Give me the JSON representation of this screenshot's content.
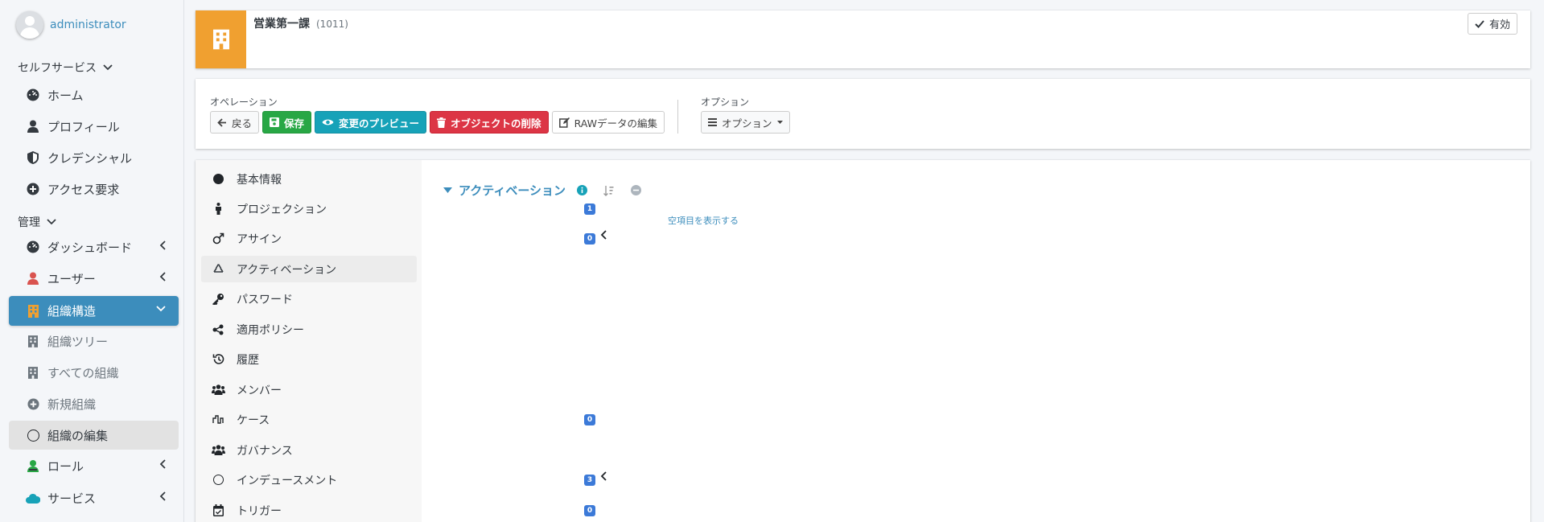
{
  "user": {
    "name": "administrator"
  },
  "sidebar": {
    "self_service_header": "セルフサービス",
    "self_items": [
      {
        "label": "ホーム",
        "icon": "dashboard-icon"
      },
      {
        "label": "プロフィール",
        "icon": "user-icon"
      },
      {
        "label": "クレデンシャル",
        "icon": "shield-icon"
      },
      {
        "label": "アクセス要求",
        "icon": "plus-circle-icon"
      }
    ],
    "admin_header": "管理",
    "admin_items": [
      {
        "label": "ダッシュボード",
        "icon": "dashboard-icon"
      },
      {
        "label": "ユーザー",
        "icon": "user-icon"
      },
      {
        "label": "組織構造",
        "icon": "building-icon"
      },
      {
        "label": "組織ツリー",
        "icon": "building-icon"
      },
      {
        "label": "すべての組織",
        "icon": "building-icon"
      },
      {
        "label": "新規組織",
        "icon": "plus-circle-icon"
      },
      {
        "label": "組織の編集",
        "icon": "circle-icon"
      },
      {
        "label": "ロール",
        "icon": "role-icon"
      },
      {
        "label": "サービス",
        "icon": "cloud-icon"
      }
    ]
  },
  "header": {
    "title": "営業第一課",
    "oid": "(1011)",
    "status": "有効"
  },
  "operations": {
    "label": "オペレーション",
    "back": "戻る",
    "save": "保存",
    "preview": "変更のプレビュー",
    "delete": "オブジェクトの削除",
    "raw": "RAWデータの編集",
    "options_label": "オプション",
    "options": "オプション"
  },
  "tabs": [
    {
      "label": "基本情報",
      "icon": "dot-icon"
    },
    {
      "label": "プロジェクション",
      "icon": "male-icon",
      "badge": "1"
    },
    {
      "label": "アサイン",
      "icon": "mars-icon",
      "badge": "0"
    },
    {
      "label": "アクティベーション",
      "icon": "recycle-icon"
    },
    {
      "label": "パスワード",
      "icon": "key-icon"
    },
    {
      "label": "適用ポリシー",
      "icon": "share-icon"
    },
    {
      "label": "履歴",
      "icon": "history-icon"
    },
    {
      "label": "メンバー",
      "icon": "users-icon"
    },
    {
      "label": "ケース",
      "icon": "wave-icon",
      "badge": "0"
    },
    {
      "label": "ガバナンス",
      "icon": "users-icon"
    },
    {
      "label": "インデュースメント",
      "icon": "circle-icon",
      "badge": "3"
    },
    {
      "label": "トリガー",
      "icon": "calendar-icon",
      "badge": "0"
    }
  ],
  "content": {
    "section_title": "アクティベーション",
    "show_empty": "空項目を表示する"
  },
  "colors": {
    "accent": "#3c8dbc",
    "org": "#f0a030",
    "success": "#28a745",
    "info": "#17a2b8",
    "danger": "#dc3545",
    "badge": "#3c7ad8"
  }
}
